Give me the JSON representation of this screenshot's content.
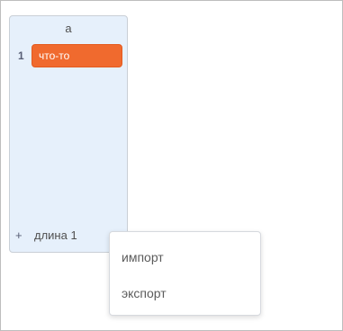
{
  "list": {
    "title": "a",
    "items": [
      {
        "index": "1",
        "value": "что-то"
      }
    ],
    "footer": {
      "add_label": "+",
      "length_label": "длина 1",
      "resize_label": "="
    }
  },
  "context_menu": {
    "items": [
      {
        "label": "импорт"
      },
      {
        "label": "экспорт"
      }
    ]
  },
  "colors": {
    "list_background": "#e6f0fb",
    "item_background": "#f06a2e"
  }
}
